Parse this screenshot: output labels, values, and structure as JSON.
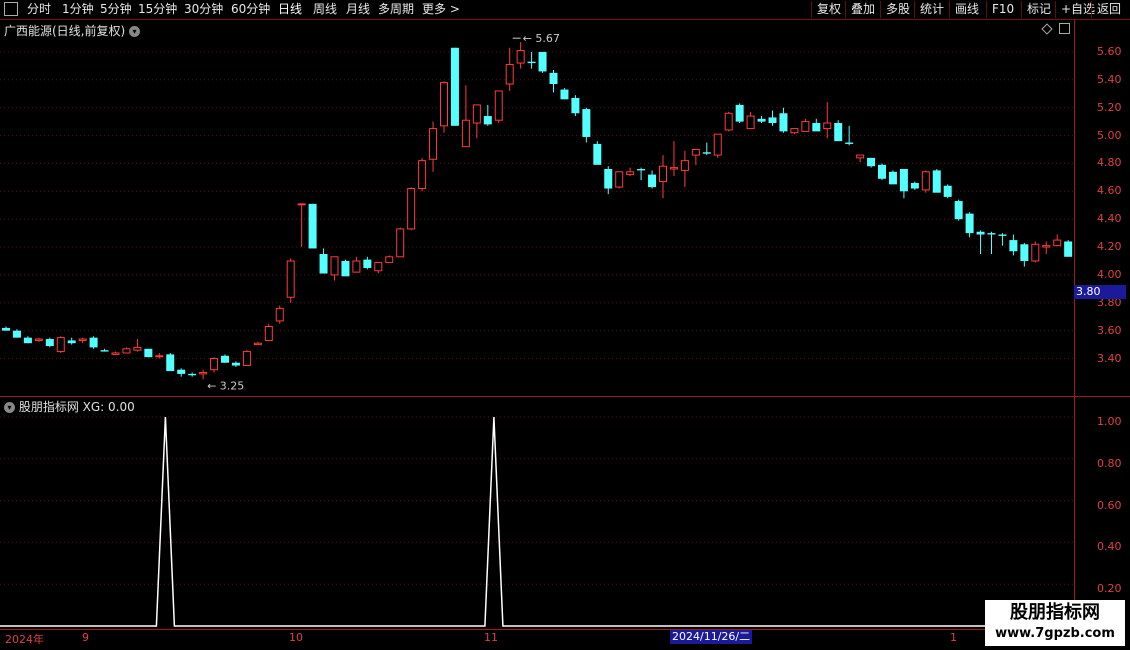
{
  "toolbar": {
    "left_items": [
      "分时",
      "1分钟",
      "5分钟",
      "15分钟",
      "30分钟",
      "60分钟",
      "日线",
      "周线",
      "月线",
      "多周期",
      "更多 >"
    ],
    "right_items": [
      "复权",
      "叠加",
      "多股",
      "统计",
      "画线",
      "F10",
      "标记",
      "+自选",
      "返回"
    ]
  },
  "main_title": "广西能源(日线,前复权)",
  "sub_title": "股朋指标网 XG: 0.00",
  "price_axis": [
    "5.60",
    "5.40",
    "5.20",
    "5.00",
    "4.80",
    "4.60",
    "4.40",
    "4.20",
    "4.00",
    "3.80",
    "3.60",
    "3.40"
  ],
  "current_price_tag": "3.80",
  "high_label": "5.67",
  "low_label": "3.25",
  "sub_axis": [
    "1.00",
    "0.80",
    "0.60",
    "0.40",
    "0.20"
  ],
  "date_labels": [
    "2024年",
    "9",
    "10",
    "11",
    "1"
  ],
  "date_cursor": "2024/11/26/二",
  "watermark": {
    "main": "股朋指标网",
    "url": "www.7gpzb.com"
  },
  "colors": {
    "up": "#ff3b3b",
    "down": "#54ffff",
    "axis": "#a01818",
    "grid": "#5a1010"
  },
  "chart_data": {
    "type": "candlestick",
    "candles": [
      [
        3.62,
        3.63,
        3.6,
        3.6
      ],
      [
        3.6,
        3.61,
        3.55,
        3.55
      ],
      [
        3.55,
        3.56,
        3.51,
        3.51
      ],
      [
        3.53,
        3.55,
        3.52,
        3.54
      ],
      [
        3.54,
        3.55,
        3.48,
        3.49
      ],
      [
        3.45,
        3.56,
        3.44,
        3.55
      ],
      [
        3.53,
        3.55,
        3.5,
        3.51
      ],
      [
        3.53,
        3.55,
        3.51,
        3.54
      ],
      [
        3.55,
        3.56,
        3.47,
        3.48
      ],
      [
        3.46,
        3.47,
        3.45,
        3.45
      ],
      [
        3.43,
        3.45,
        3.43,
        3.44
      ],
      [
        3.44,
        3.48,
        3.44,
        3.47
      ],
      [
        3.46,
        3.54,
        3.45,
        3.48
      ],
      [
        3.47,
        3.47,
        3.41,
        3.41
      ],
      [
        3.42,
        3.44,
        3.4,
        3.42
      ],
      [
        3.43,
        3.44,
        3.32,
        3.31
      ],
      [
        3.32,
        3.33,
        3.27,
        3.29
      ],
      [
        3.29,
        3.3,
        3.27,
        3.28
      ],
      [
        3.29,
        3.32,
        3.25,
        3.3
      ],
      [
        3.32,
        3.41,
        3.3,
        3.4
      ],
      [
        3.42,
        3.43,
        3.37,
        3.37
      ],
      [
        3.37,
        3.38,
        3.34,
        3.35
      ],
      [
        3.35,
        3.46,
        3.35,
        3.45
      ],
      [
        3.5,
        3.52,
        3.5,
        3.51
      ],
      [
        3.53,
        3.65,
        3.53,
        3.63
      ],
      [
        3.67,
        3.78,
        3.65,
        3.76
      ],
      [
        3.84,
        4.12,
        3.8,
        4.1
      ],
      [
        4.51,
        4.51,
        4.2,
        4.51
      ],
      [
        4.51,
        4.51,
        4.19,
        4.19
      ],
      [
        4.15,
        4.19,
        4.08,
        4.01
      ],
      [
        4.0,
        4.13,
        3.96,
        4.13
      ],
      [
        4.1,
        4.11,
        4.03,
        3.99
      ],
      [
        4.02,
        4.13,
        4.03,
        4.1
      ],
      [
        4.11,
        4.13,
        4.04,
        4.05
      ],
      [
        4.03,
        4.09,
        4.01,
        4.09
      ],
      [
        4.09,
        4.14,
        4.09,
        4.13
      ],
      [
        4.13,
        4.34,
        4.13,
        4.33
      ],
      [
        4.33,
        4.63,
        4.32,
        4.62
      ],
      [
        4.62,
        4.84,
        4.6,
        4.82
      ],
      [
        4.83,
        5.1,
        4.74,
        5.05
      ],
      [
        5.07,
        5.39,
        5.02,
        5.38
      ],
      [
        5.63,
        5.63,
        5.07,
        5.07
      ],
      [
        4.92,
        5.36,
        4.93,
        5.11
      ],
      [
        5.09,
        5.21,
        4.98,
        5.22
      ],
      [
        5.14,
        5.22,
        5.07,
        5.08
      ],
      [
        5.11,
        5.32,
        5.09,
        5.32
      ],
      [
        5.37,
        5.63,
        5.32,
        5.51
      ],
      [
        5.52,
        5.67,
        5.48,
        5.61
      ],
      [
        5.53,
        5.6,
        5.48,
        5.52
      ],
      [
        5.6,
        5.6,
        5.45,
        5.46
      ],
      [
        5.45,
        5.47,
        5.31,
        5.37
      ],
      [
        5.33,
        5.34,
        5.26,
        5.26
      ],
      [
        5.27,
        5.29,
        5.14,
        5.16
      ],
      [
        5.19,
        5.2,
        4.95,
        4.99
      ],
      [
        4.94,
        4.96,
        4.8,
        4.79
      ],
      [
        4.76,
        4.78,
        4.58,
        4.62
      ],
      [
        4.63,
        4.74,
        4.62,
        4.74
      ],
      [
        4.72,
        4.77,
        4.71,
        4.74
      ],
      [
        4.76,
        4.77,
        4.68,
        4.75
      ],
      [
        4.72,
        4.75,
        4.62,
        4.63
      ],
      [
        4.67,
        4.86,
        4.55,
        4.78
      ],
      [
        4.76,
        4.96,
        4.71,
        4.77
      ],
      [
        4.75,
        4.89,
        4.63,
        4.82
      ],
      [
        4.86,
        4.9,
        4.79,
        4.9
      ],
      [
        4.88,
        4.95,
        4.86,
        4.87
      ],
      [
        4.86,
        5.0,
        4.84,
        5.01
      ],
      [
        5.04,
        5.17,
        5.03,
        5.16
      ],
      [
        5.22,
        5.23,
        5.09,
        5.1
      ],
      [
        5.05,
        5.17,
        5.06,
        5.14
      ],
      [
        5.12,
        5.14,
        5.09,
        5.1
      ],
      [
        5.13,
        5.18,
        5.07,
        5.09
      ],
      [
        5.16,
        5.2,
        5.02,
        5.03
      ],
      [
        5.02,
        5.05,
        5.01,
        5.05
      ],
      [
        5.03,
        5.12,
        5.03,
        5.1
      ],
      [
        5.09,
        5.12,
        5.07,
        5.03
      ],
      [
        5.05,
        5.24,
        4.98,
        5.09
      ],
      [
        5.09,
        5.11,
        4.96,
        4.96
      ],
      [
        4.95,
        5.07,
        4.93,
        4.94
      ],
      [
        4.84,
        4.86,
        4.81,
        4.86
      ],
      [
        4.84,
        4.84,
        4.77,
        4.78
      ],
      [
        4.79,
        4.8,
        4.68,
        4.69
      ],
      [
        4.74,
        4.75,
        4.66,
        4.65
      ],
      [
        4.76,
        4.73,
        4.55,
        4.6
      ],
      [
        4.66,
        4.67,
        4.61,
        4.62
      ],
      [
        4.61,
        4.75,
        4.59,
        4.74
      ],
      [
        4.75,
        4.76,
        4.6,
        4.59
      ],
      [
        4.64,
        4.65,
        4.55,
        4.56
      ],
      [
        4.53,
        4.54,
        4.39,
        4.4
      ],
      [
        4.44,
        4.45,
        4.27,
        4.3
      ],
      [
        4.31,
        4.32,
        4.15,
        4.29
      ],
      [
        4.3,
        4.31,
        4.15,
        4.29
      ],
      [
        4.29,
        4.3,
        4.21,
        4.28
      ],
      [
        4.25,
        4.29,
        4.14,
        4.17
      ],
      [
        4.22,
        4.23,
        4.06,
        4.1
      ],
      [
        4.1,
        4.24,
        4.09,
        4.22
      ],
      [
        4.2,
        4.24,
        4.15,
        4.21
      ],
      [
        4.21,
        4.29,
        4.22,
        4.25
      ],
      [
        4.24,
        4.25,
        4.14,
        4.13
      ]
    ],
    "xg_signal_positions": [
      12,
      42
    ]
  }
}
